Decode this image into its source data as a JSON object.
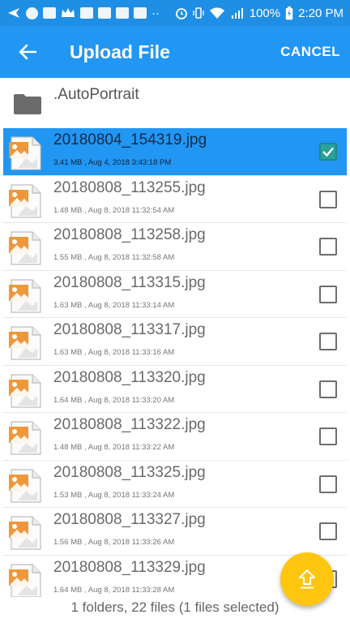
{
  "status_bar": {
    "battery": "100%",
    "time": "2:20 PM",
    "icons": [
      "share-icon",
      "pinterest-icon",
      "linkedin-icon",
      "crown-icon",
      "gmail-icon",
      "youtube-icon",
      "youtube-icon",
      "youtube-icon",
      "more-dots-icon",
      "alarm-icon",
      "vibrate-icon",
      "wifi-icon",
      "signal-icon",
      "battery-icon"
    ]
  },
  "header": {
    "title": "Upload File",
    "cancel_label": "CANCEL",
    "back_icon": "arrow-left-icon"
  },
  "folders": [
    {
      "name": ".AutoPortrait",
      "icon": "folder-icon"
    }
  ],
  "files": [
    {
      "name": "20180804_154319.jpg",
      "meta": "3.41 MB , Aug 4, 2018 3:43:18 PM",
      "selected": true
    },
    {
      "name": "20180808_113255.jpg",
      "meta": "1.48 MB , Aug 8, 2018 11:32:54 AM",
      "selected": false
    },
    {
      "name": "20180808_113258.jpg",
      "meta": "1.55 MB , Aug 8, 2018 11:32:58 AM",
      "selected": false
    },
    {
      "name": "20180808_113315.jpg",
      "meta": "1.63 MB , Aug 8, 2018 11:33:14 AM",
      "selected": false
    },
    {
      "name": "20180808_113317.jpg",
      "meta": "1.63 MB , Aug 8, 2018 11:33:16 AM",
      "selected": false
    },
    {
      "name": "20180808_113320.jpg",
      "meta": "1.64 MB , Aug 8, 2018 11:33:20 AM",
      "selected": false
    },
    {
      "name": "20180808_113322.jpg",
      "meta": "1.48 MB , Aug 8, 2018 11:33:22 AM",
      "selected": false
    },
    {
      "name": "20180808_113325.jpg",
      "meta": "1.53 MB , Aug 8, 2018 11:33:24 AM",
      "selected": false
    },
    {
      "name": "20180808_113327.jpg",
      "meta": "1.56 MB , Aug 8, 2018 11:33:26 AM",
      "selected": false
    },
    {
      "name": "20180808_113329.jpg",
      "meta": "1.64 MB , Aug 8, 2018 11:33:28 AM",
      "selected": false
    }
  ],
  "footer": {
    "summary": "1 folders, 22 files (1 files selected)"
  },
  "fab": {
    "icon": "upload-icon"
  },
  "colors": {
    "status_bar": "#1f8fe6",
    "app_bar": "#2196f3",
    "selected_row": "#2196f3",
    "checkbox_checked": "#27a39b",
    "fab": "#ffc60f",
    "image_icon_orange": "#f0973a"
  }
}
